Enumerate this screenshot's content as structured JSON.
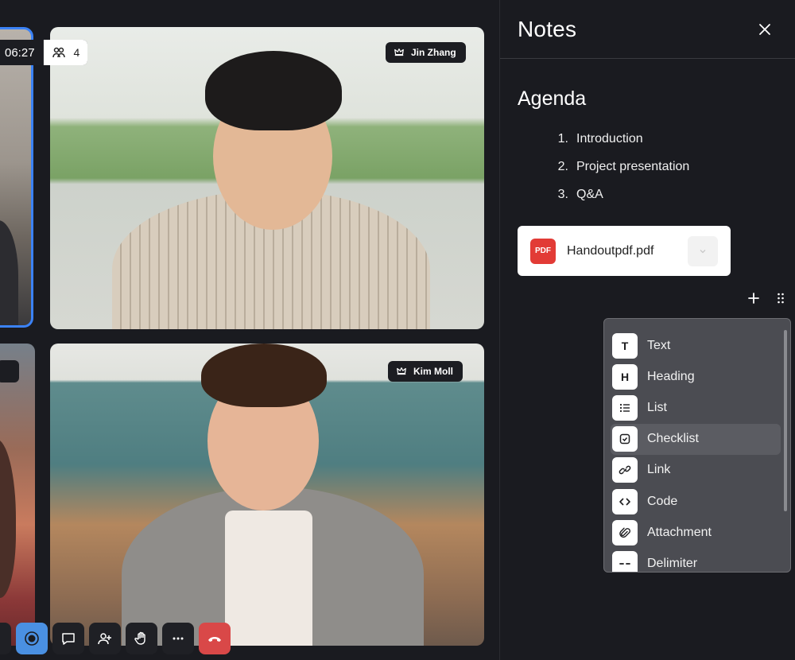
{
  "call": {
    "timer": "06:27",
    "participant_count": "4",
    "participants": [
      {
        "name": "Jin Zhang"
      },
      {
        "name": "Kim Moll"
      }
    ]
  },
  "toolbar": {
    "icons": [
      "record-icon",
      "chat-icon",
      "add-person-icon",
      "raise-hand-icon",
      "more-icon",
      "hang-up-icon"
    ]
  },
  "notes": {
    "title": "Notes",
    "agenda_title": "Agenda",
    "agenda_items": [
      {
        "num": "1.",
        "text": "Introduction"
      },
      {
        "num": "2.",
        "text": "Project presentation"
      },
      {
        "num": "3.",
        "text": "Q&A"
      }
    ],
    "attachment": {
      "icon_label": "PDF",
      "name": "Handoutpdf.pdf"
    },
    "block_menu": [
      {
        "icon": "T",
        "label": "Text"
      },
      {
        "icon": "H",
        "label": "Heading"
      },
      {
        "icon": "list-icon",
        "label": "List"
      },
      {
        "icon": "checklist-icon",
        "label": "Checklist"
      },
      {
        "icon": "link-icon",
        "label": "Link"
      },
      {
        "icon": "code-icon",
        "label": "Code"
      },
      {
        "icon": "attachment-icon",
        "label": "Attachment"
      },
      {
        "icon": "delimiter-icon",
        "label": "Delimiter"
      }
    ]
  },
  "colors": {
    "background": "#18191e",
    "active_speaker_border": "#3b82f6",
    "record_button": "#4a90e2",
    "hangup_button": "#d94848",
    "pdf_red": "#e23b36"
  }
}
